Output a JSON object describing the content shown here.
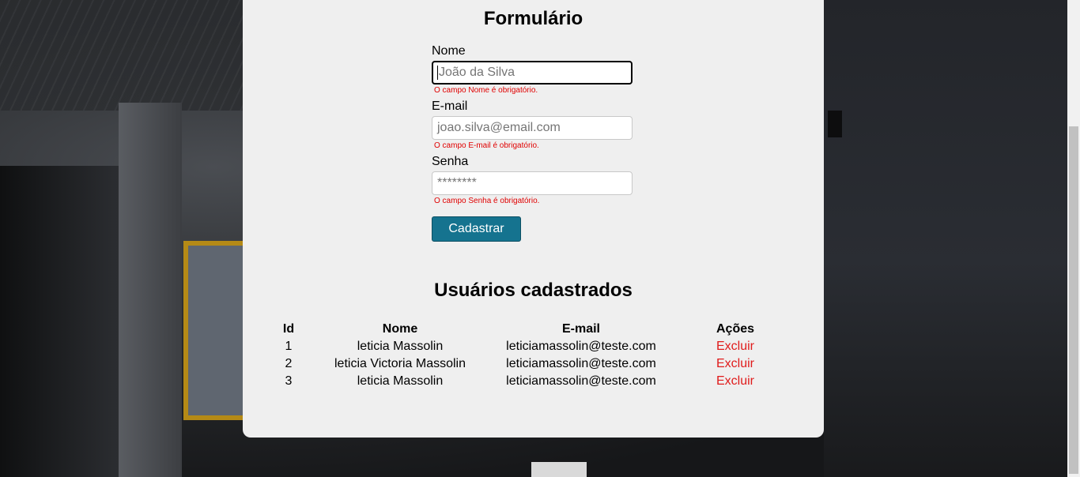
{
  "form": {
    "title": "Formulário",
    "nome_label": "Nome",
    "nome_placeholder": "João da Silva",
    "nome_error": "O campo Nome é obrigatório.",
    "email_label": "E-mail",
    "email_placeholder": "joao.silva@email.com",
    "email_error": "O campo E-mail é obrigatório.",
    "senha_label": "Senha",
    "senha_placeholder": "********",
    "senha_error": "O campo Senha é obrigatório.",
    "submit_label": "Cadastrar"
  },
  "users": {
    "title": "Usuários cadastrados",
    "columns": [
      "Id",
      "Nome",
      "E-mail",
      "Ações"
    ],
    "rows": [
      {
        "id": "1",
        "nome": "leticia Massolin",
        "email": "leticiamassolin@teste.com",
        "acao": "Excluir"
      },
      {
        "id": "2",
        "nome": "leticia Victoria Massolin",
        "email": "leticiamassolin@teste.com",
        "acao": "Excluir"
      },
      {
        "id": "3",
        "nome": "leticia Massolin",
        "email": "leticiamassolin@teste.com",
        "acao": "Excluir"
      }
    ]
  },
  "colors": {
    "button": "#15738f",
    "error": "#e00000",
    "link": "#e01b1b",
    "card": "#efefef"
  }
}
